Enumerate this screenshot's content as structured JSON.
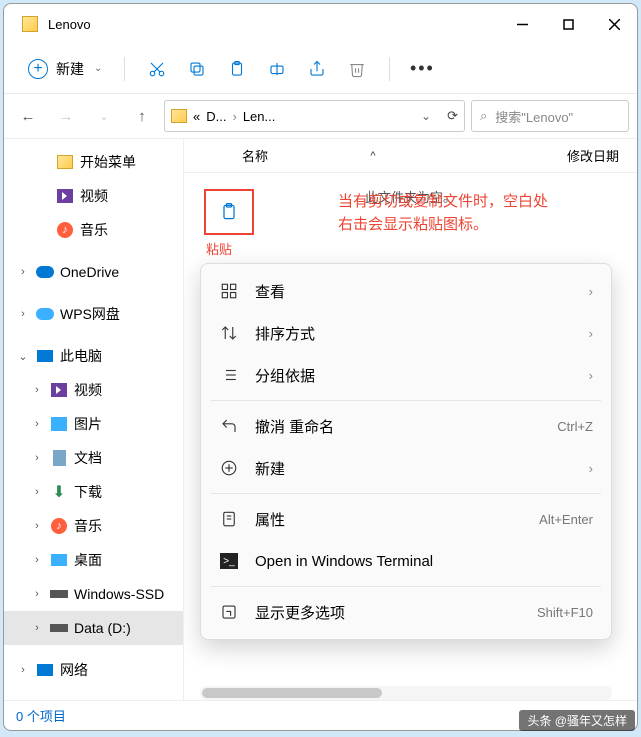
{
  "window": {
    "title": "Lenovo"
  },
  "toolbar": {
    "new_label": "新建"
  },
  "address": {
    "crumb_prefix": "«",
    "crumb1": "D...",
    "crumb2": "Len...",
    "sep": "›"
  },
  "search": {
    "placeholder": "搜索\"Lenovo\""
  },
  "columns": {
    "name": "名称",
    "modified": "修改日期"
  },
  "empty_text": "此文件夹为空。",
  "paste": {
    "label": "粘贴"
  },
  "annotation": {
    "line1": "当有剪切或复制文件时，空白处",
    "line2": "右击会显示粘贴图标。"
  },
  "sidebar": {
    "items": [
      {
        "label": "开始菜单",
        "icon": "folder",
        "indent": 32
      },
      {
        "label": "视频",
        "icon": "video",
        "indent": 32
      },
      {
        "label": "音乐",
        "icon": "music",
        "indent": 32
      },
      {
        "label": "OneDrive",
        "icon": "onedrive",
        "indent": 12,
        "exp": ">"
      },
      {
        "label": "WPS网盘",
        "icon": "wps",
        "indent": 12,
        "exp": ">"
      },
      {
        "label": "此电脑",
        "icon": "pc",
        "indent": 12,
        "exp": "v"
      },
      {
        "label": "视频",
        "icon": "video",
        "indent": 26,
        "exp": ">"
      },
      {
        "label": "图片",
        "icon": "pictures",
        "indent": 26,
        "exp": ">"
      },
      {
        "label": "文档",
        "icon": "documents",
        "indent": 26,
        "exp": ">"
      },
      {
        "label": "下载",
        "icon": "downloads",
        "indent": 26,
        "exp": ">"
      },
      {
        "label": "音乐",
        "icon": "music",
        "indent": 26,
        "exp": ">"
      },
      {
        "label": "桌面",
        "icon": "desktop",
        "indent": 26,
        "exp": ">"
      },
      {
        "label": "Windows-SSD",
        "icon": "drive",
        "indent": 26,
        "exp": ">"
      },
      {
        "label": "Data (D:)",
        "icon": "drive",
        "indent": 26,
        "exp": ">",
        "selected": true
      },
      {
        "label": "网络",
        "icon": "network",
        "indent": 12,
        "exp": ">"
      }
    ]
  },
  "context_menu": {
    "items": [
      {
        "label": "查看",
        "icon": "view",
        "arrow": true
      },
      {
        "label": "排序方式",
        "icon": "sort",
        "arrow": true
      },
      {
        "label": "分组依据",
        "icon": "group",
        "arrow": true
      },
      {
        "divider": true
      },
      {
        "label": "撤消 重命名",
        "icon": "undo",
        "shortcut": "Ctrl+Z"
      },
      {
        "label": "新建",
        "icon": "new",
        "arrow": true
      },
      {
        "divider": true
      },
      {
        "label": "属性",
        "icon": "properties",
        "shortcut": "Alt+Enter"
      },
      {
        "label": "Open in Windows Terminal",
        "icon": "terminal"
      },
      {
        "divider": true
      },
      {
        "label": "显示更多选项",
        "icon": "more",
        "shortcut": "Shift+F10"
      }
    ]
  },
  "statusbar": {
    "text": "0 个项目"
  },
  "watermark": "头条 @骚年又怎样"
}
